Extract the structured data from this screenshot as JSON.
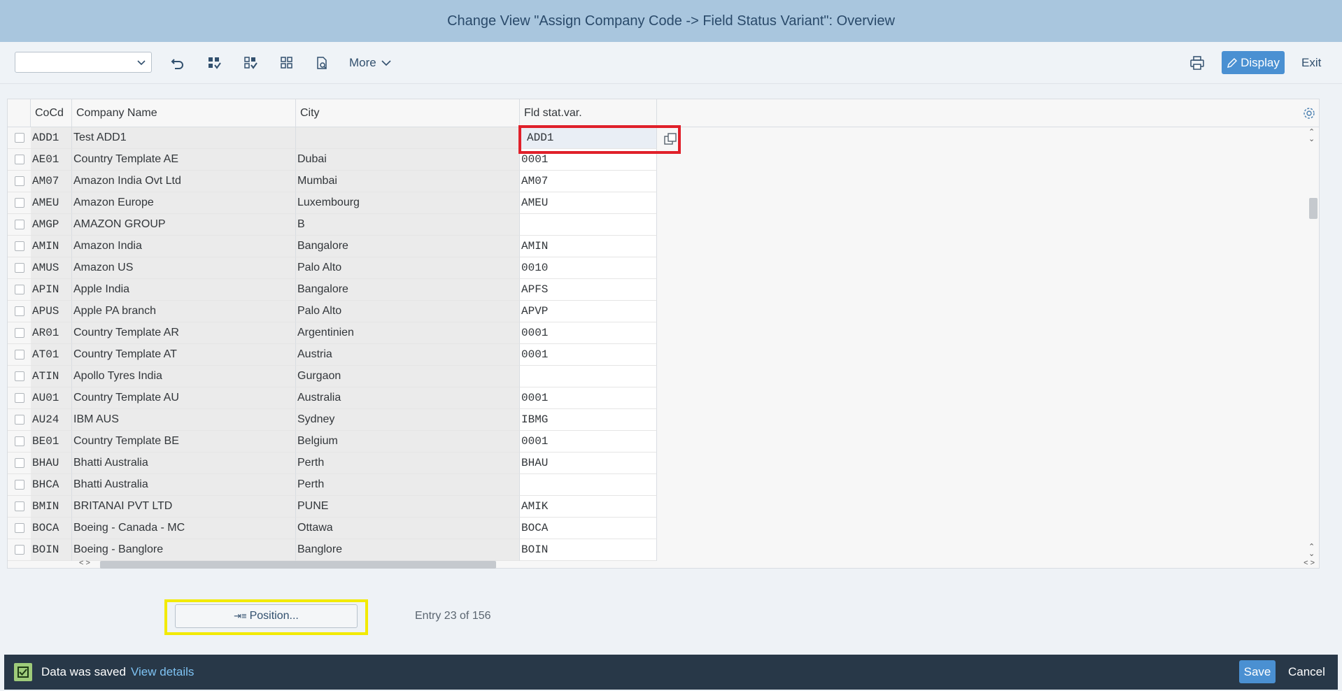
{
  "window": {
    "title": "Change View \"Assign Company Code -> Field Status Variant\": Overview"
  },
  "toolbar": {
    "select_value": "",
    "more_label": "More",
    "display_label": "Display",
    "exit_label": "Exit"
  },
  "table": {
    "columns": [
      "CoCd",
      "Company Name",
      "City",
      "Fld stat.var."
    ],
    "rows": [
      {
        "code": "ADD1",
        "name": "Test ADD1",
        "city": "",
        "fsv": "ADD1"
      },
      {
        "code": "AE01",
        "name": "Country Template AE",
        "city": "Dubai",
        "fsv": "0001"
      },
      {
        "code": "AM07",
        "name": "Amazon India Ovt Ltd",
        "city": "Mumbai",
        "fsv": "AM07"
      },
      {
        "code": "AMEU",
        "name": "Amazon Europe",
        "city": "Luxembourg",
        "fsv": "AMEU"
      },
      {
        "code": "AMGP",
        "name": "AMAZON GROUP",
        "city": "B",
        "fsv": ""
      },
      {
        "code": "AMIN",
        "name": "Amazon India",
        "city": "Bangalore",
        "fsv": "AMIN"
      },
      {
        "code": "AMUS",
        "name": "Amazon US",
        "city": "Palo Alto",
        "fsv": "0010"
      },
      {
        "code": "APIN",
        "name": "Apple India",
        "city": "Bangalore",
        "fsv": "APFS"
      },
      {
        "code": "APUS",
        "name": "Apple PA branch",
        "city": "Palo Alto",
        "fsv": "APVP"
      },
      {
        "code": "AR01",
        "name": "Country Template AR",
        "city": "Argentinien",
        "fsv": "0001"
      },
      {
        "code": "AT01",
        "name": "Country Template AT",
        "city": "Austria",
        "fsv": "0001"
      },
      {
        "code": "ATIN",
        "name": "Apollo Tyres India",
        "city": "Gurgaon",
        "fsv": ""
      },
      {
        "code": "AU01",
        "name": "Country Template AU",
        "city": "Australia",
        "fsv": "0001"
      },
      {
        "code": "AU24",
        "name": "IBM AUS",
        "city": "Sydney",
        "fsv": "IBMG"
      },
      {
        "code": "BE01",
        "name": "Country Template BE",
        "city": "Belgium",
        "fsv": "0001"
      },
      {
        "code": "BHAU",
        "name": "Bhatti Australia",
        "city": "Perth",
        "fsv": "BHAU"
      },
      {
        "code": "BHCA",
        "name": "Bhatti Australia",
        "city": "Perth",
        "fsv": ""
      },
      {
        "code": "BMIN",
        "name": "BRITANAI PVT LTD",
        "city": "PUNE",
        "fsv": "AMIK"
      },
      {
        "code": "BOCA",
        "name": "Boeing - Canada - MC",
        "city": "Ottawa",
        "fsv": "BOCA"
      },
      {
        "code": "BOIN",
        "name": "Boeing - Banglore",
        "city": "Banglore",
        "fsv": "BOIN"
      }
    ]
  },
  "footer": {
    "position_label": "Position...",
    "entry_text": "Entry 23 of 156"
  },
  "status": {
    "message": "Data was saved",
    "link": "View details",
    "save_label": "Save",
    "cancel_label": "Cancel"
  },
  "colors": {
    "title_bar": "#a9c6de",
    "accent": "#4a90d2",
    "status_bar": "#283848",
    "highlight_red": "#e0202a",
    "highlight_yellow": "#f2ea00"
  }
}
